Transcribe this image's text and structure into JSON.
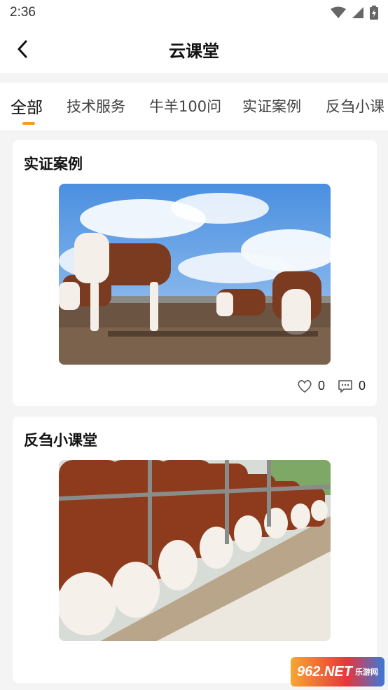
{
  "status_bar": {
    "time": "2:36"
  },
  "header": {
    "title": "云课堂"
  },
  "tabs": [
    {
      "label": "全部",
      "active": true
    },
    {
      "label": "技术服务"
    },
    {
      "label": "牛羊100问"
    },
    {
      "label": "实证案例"
    },
    {
      "label": "反刍小课"
    }
  ],
  "cards": [
    {
      "title": "实证案例",
      "likes": "0",
      "comments": "0"
    },
    {
      "title": "反刍小课堂"
    }
  ],
  "watermark": {
    "text": "962.NET",
    "sub": "乐游网"
  },
  "colors": {
    "accent": "#f0a020",
    "background": "#f4f4f4"
  }
}
